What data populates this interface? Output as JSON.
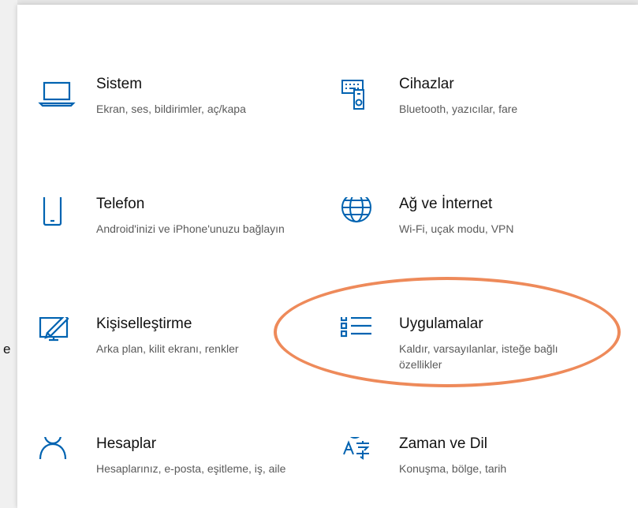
{
  "left_stub": {
    "char": "e"
  },
  "tiles": [
    {
      "title": "Sistem",
      "desc": "Ekran, ses, bildirimler, aç/kapa",
      "icon": "laptop-icon"
    },
    {
      "title": "Cihazlar",
      "desc": "Bluetooth, yazıcılar, fare",
      "icon": "devices-icon"
    },
    {
      "title": "Telefon",
      "desc": "Android'inizi ve iPhone'unuzu bağlayın",
      "icon": "phone-icon"
    },
    {
      "title": "Ağ ve İnternet",
      "desc": "Wi-Fi, uçak modu, VPN",
      "icon": "globe-icon"
    },
    {
      "title": "Kişiselleştirme",
      "desc": "Arka plan, kilit ekranı, renkler",
      "icon": "personalization-icon"
    },
    {
      "title": "Uygulamalar",
      "desc": "Kaldır, varsayılanlar, isteğe bağlı özellikler",
      "icon": "apps-list-icon"
    },
    {
      "title": "Hesaplar",
      "desc": "Hesaplarınız, e-posta, eşitleme, iş, aile",
      "icon": "person-icon"
    },
    {
      "title": "Zaman ve Dil",
      "desc": "Konuşma, bölge, tarih",
      "icon": "time-language-icon"
    }
  ],
  "colors": {
    "icon": "#0063b1",
    "highlight": "#ee8a5a"
  }
}
